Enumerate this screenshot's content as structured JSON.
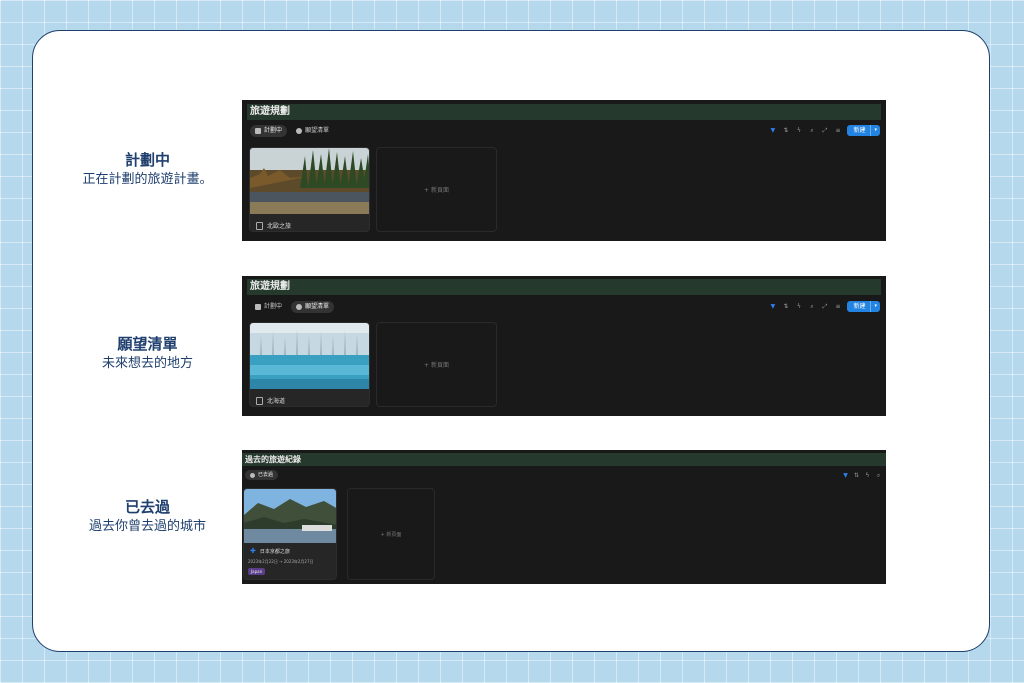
{
  "labels": [
    {
      "title": "計劃中",
      "desc": "正在計劃的旅遊計畫。"
    },
    {
      "title": "願望清單",
      "desc": "未來想去的地方"
    },
    {
      "title": "已去過",
      "desc": "過去你曾去過的城市"
    }
  ],
  "panel1": {
    "title": "旅遊規劃",
    "tabs": [
      "計劃中",
      "願望清單"
    ],
    "new_label": "新建",
    "card_name": "北歐之旅",
    "new_page": "+ 新頁面"
  },
  "panel2": {
    "title": "旅遊規劃",
    "tabs": [
      "計劃中",
      "願望清單"
    ],
    "new_label": "新建",
    "card_name": "北海道",
    "new_page": "+ 新頁面"
  },
  "panel3": {
    "title": "過去的旅遊紀錄",
    "tabs": [
      "已去過"
    ],
    "card_name": "日本京都之旅",
    "date": "2023年2月22日 → 2023年2月27日",
    "tag": "Japan",
    "new_page": "+ 新頁面"
  },
  "icons": [
    "calendar-icon",
    "wish-icon",
    "filter-icon",
    "sort-icon",
    "lightning-icon",
    "search-icon",
    "expand-icon",
    "settings-icon",
    "document-icon",
    "plus-icon"
  ],
  "colors": {
    "accent": "#2383e2",
    "titlebar": "#25392c",
    "panel_bg": "#191919",
    "label": "#1f3f6e"
  }
}
